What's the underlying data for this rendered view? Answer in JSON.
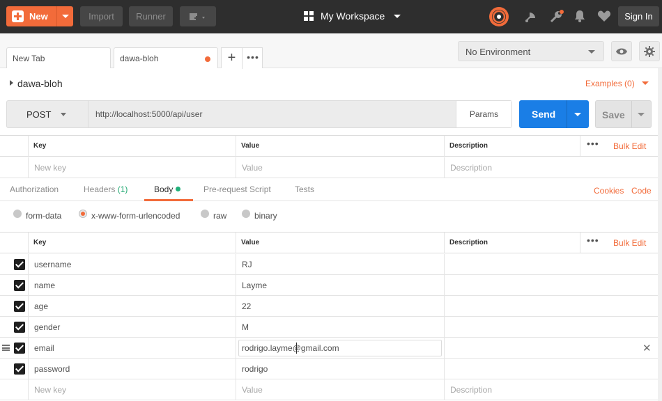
{
  "topbar": {
    "new_label": "New",
    "import_label": "Import",
    "runner_label": "Runner",
    "workspace_label": "My Workspace",
    "signin_label": "Sign In"
  },
  "tabs": [
    {
      "label": "New Tab"
    },
    {
      "label": "dawa-bloh",
      "unsaved": true
    }
  ],
  "environment": {
    "selected": "No Environment"
  },
  "request": {
    "name": "dawa-bloh",
    "examples_label": "Examples (0)",
    "method": "POST",
    "url": "http://localhost:5000/api/user",
    "params_label": "Params",
    "send_label": "Send",
    "save_label": "Save"
  },
  "params_table": {
    "headers": {
      "key": "Key",
      "value": "Value",
      "description": "Description"
    },
    "bulk_edit": "Bulk Edit",
    "placeholder": {
      "key": "New key",
      "value": "Value",
      "description": "Description"
    }
  },
  "subtabs": {
    "authorization": "Authorization",
    "headers": "Headers",
    "headers_count": "(1)",
    "body": "Body",
    "prerequest": "Pre-request Script",
    "tests": "Tests",
    "cookies": "Cookies",
    "code": "Code"
  },
  "body_modes": {
    "form_data": "form-data",
    "urlencoded": "x-www-form-urlencoded",
    "raw": "raw",
    "binary": "binary",
    "selected": "x-www-form-urlencoded"
  },
  "body_table": {
    "headers": {
      "key": "Key",
      "value": "Value",
      "description": "Description"
    },
    "bulk_edit": "Bulk Edit",
    "rows": [
      {
        "key": "username",
        "value": "RJ",
        "checked": true
      },
      {
        "key": "name",
        "value": "Layme",
        "checked": true
      },
      {
        "key": "age",
        "value": "22",
        "checked": true
      },
      {
        "key": "gender",
        "value": "M",
        "checked": true
      },
      {
        "key": "email",
        "value": "rodrigo.layme@gmail.com",
        "checked": true
      },
      {
        "key": "password",
        "value": "rodrigo",
        "checked": true
      }
    ],
    "placeholder": {
      "key": "New key",
      "value": "Value",
      "description": "Description"
    }
  },
  "colors": {
    "accent": "#f26b3a",
    "send": "#1a7ee6",
    "topbar": "#2e2e2e"
  }
}
